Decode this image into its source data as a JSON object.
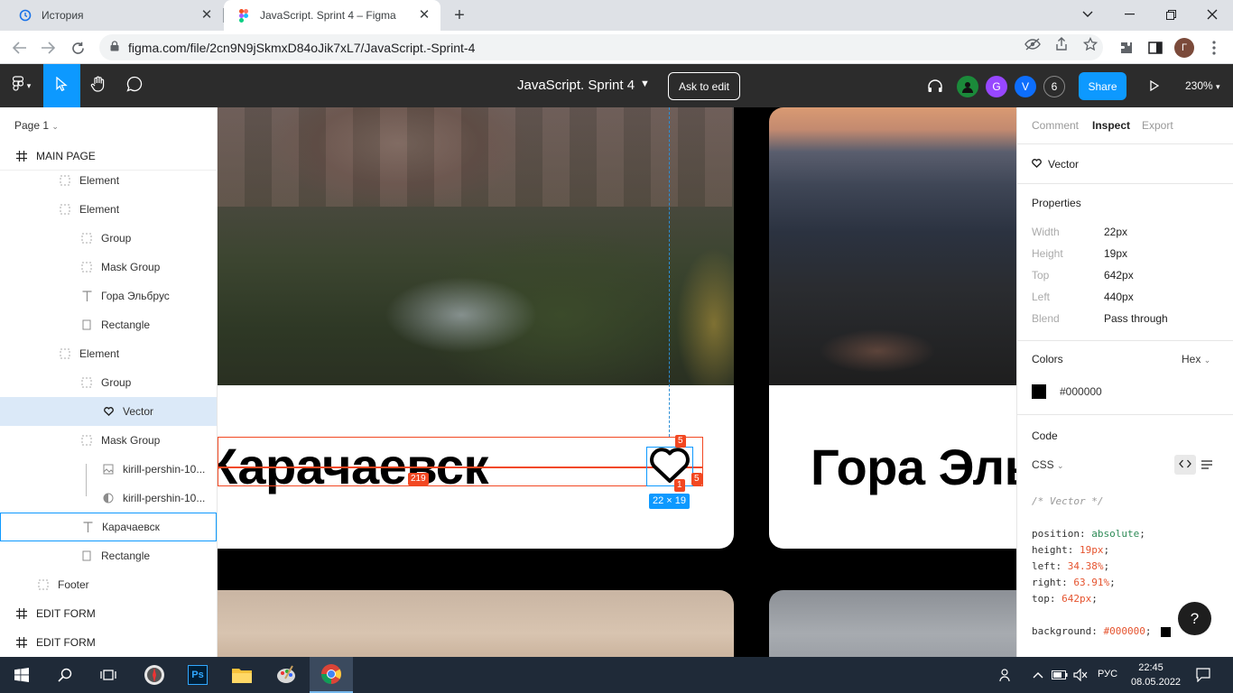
{
  "browser": {
    "tabs": [
      {
        "title": "История",
        "icon": "history-icon"
      },
      {
        "title": "JavaScript. Sprint 4 – Figma",
        "icon": "figma-icon"
      }
    ],
    "url": "figma.com/file/2cn9N9jSkmxD84oJik7xL7/JavaScript.-Sprint-4",
    "profile_initial": "Г"
  },
  "figma": {
    "doc_title": "JavaScript. Sprint 4",
    "ask_to_edit": "Ask to edit",
    "share": "Share",
    "zoom": "230%",
    "collaborators": [
      {
        "initial": "",
        "color": "#1b8a3a"
      },
      {
        "initial": "G",
        "color": "#9747ff"
      },
      {
        "initial": "V",
        "color": "#0d6efd"
      }
    ],
    "more_count": "6"
  },
  "layers": {
    "page": "Page 1",
    "items": [
      {
        "label": "MAIN PAGE",
        "icon": "frame-icon",
        "kind": "frame"
      },
      {
        "label": "Element",
        "icon": "group-icon"
      },
      {
        "label": "Element",
        "icon": "group-icon"
      },
      {
        "label": "Group",
        "icon": "group-icon"
      },
      {
        "label": "Mask Group",
        "icon": "group-icon"
      },
      {
        "label": "Гора Эльбрус",
        "icon": "text-icon"
      },
      {
        "label": "Rectangle",
        "icon": "rectangle-icon"
      },
      {
        "label": "Element",
        "icon": "group-icon"
      },
      {
        "label": "Group",
        "icon": "group-icon"
      },
      {
        "label": "Vector",
        "icon": "vector-heart-icon",
        "selected": true
      },
      {
        "label": "Mask Group",
        "icon": "group-icon"
      },
      {
        "label": "kirill-pershin-10...",
        "icon": "image-icon"
      },
      {
        "label": "kirill-pershin-10...",
        "icon": "mask-icon"
      },
      {
        "label": "Карачаевск",
        "icon": "text-icon",
        "hovered": true
      },
      {
        "label": "Rectangle",
        "icon": "rectangle-icon"
      },
      {
        "label": "Footer",
        "icon": "group-icon"
      },
      {
        "label": "EDIT FORM",
        "icon": "frame-icon",
        "kind": "frame"
      },
      {
        "label": "EDIT FORM",
        "icon": "frame-icon",
        "kind": "frame"
      }
    ]
  },
  "canvas": {
    "card1_title": "Карачаевск",
    "card2_title": "Гора Эль",
    "measure_top": "5",
    "measure_right": "5",
    "measure_bottom": "1",
    "measure_left": "219",
    "selection_size": "22 × 19"
  },
  "inspect": {
    "tabs": [
      "Comment",
      "Inspect",
      "Export"
    ],
    "active_tab": "Inspect",
    "layer_name": "Vector",
    "properties_title": "Properties",
    "properties": [
      {
        "key": "Width",
        "value": "22px"
      },
      {
        "key": "Height",
        "value": "19px"
      },
      {
        "key": "Top",
        "value": "642px"
      },
      {
        "key": "Left",
        "value": "440px"
      },
      {
        "key": "Blend",
        "value": "Pass through"
      }
    ],
    "colors_title": "Colors",
    "color_format": "Hex",
    "color_value": "#000000",
    "code_title": "Code",
    "code_lang": "CSS",
    "code_comment": "/* Vector */",
    "code_lines": [
      {
        "prop": "position:",
        "val": "absolute",
        "kind": "kw"
      },
      {
        "prop": "height:",
        "val": "19px",
        "kind": "val"
      },
      {
        "prop": "left:",
        "val": "34.38%",
        "kind": "val"
      },
      {
        "prop": "right:",
        "val": "63.91%",
        "kind": "val"
      },
      {
        "prop": "top:",
        "val": "642px",
        "kind": "val"
      }
    ],
    "code_bg_prop": "background:",
    "code_bg_val": "#000000",
    "help": "?"
  },
  "taskbar": {
    "time": "22:45",
    "date": "08.05.2022",
    "lang": "РУС"
  }
}
